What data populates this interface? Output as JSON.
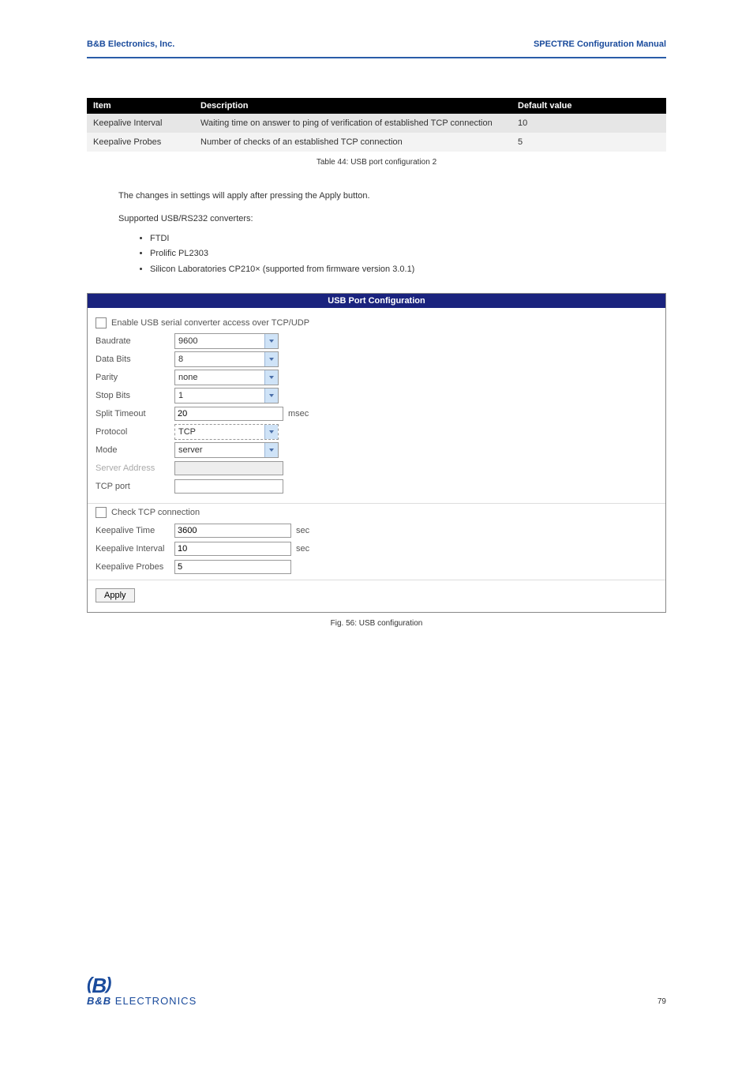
{
  "header": {
    "left": "B&B Electronics, Inc.",
    "right": "SPECTRE Configuration Manual"
  },
  "table": {
    "headers": [
      "Item",
      "Description",
      "Default value"
    ],
    "rows": [
      {
        "item": "Keepalive Interval",
        "desc": "Waiting time on answer to ping of verification of established TCP connection",
        "def": "10"
      },
      {
        "item": "Keepalive Probes",
        "desc": "Number of checks of an established TCP connection",
        "def": "5"
      }
    ],
    "caption": "Table 44: USB port configuration 2"
  },
  "para1": "The changes in settings will apply after pressing the Apply button.",
  "supported_intro": "Supported USB/RS232 converters:",
  "supported": [
    "FTDI",
    "Prolific PL2303",
    "Silicon Laboratories CP210×  (supported from firmware version 3.0.1)"
  ],
  "panel": {
    "title": "USB Port Configuration",
    "enable_label": "Enable USB serial converter access over TCP/UDP",
    "rows": [
      {
        "label": "Baudrate",
        "type": "select",
        "value": "9600"
      },
      {
        "label": "Data Bits",
        "type": "select",
        "value": "8"
      },
      {
        "label": "Parity",
        "type": "select",
        "value": "none"
      },
      {
        "label": "Stop Bits",
        "type": "select",
        "value": "1"
      },
      {
        "label": "Split Timeout",
        "type": "input",
        "value": "20",
        "unit": "msec"
      },
      {
        "label": "Protocol",
        "type": "select",
        "value": "TCP"
      },
      {
        "label": "Mode",
        "type": "select",
        "value": "server"
      },
      {
        "label": "Server Address",
        "type": "input",
        "value": "",
        "disabled": true
      },
      {
        "label": "TCP port",
        "type": "input",
        "value": ""
      }
    ],
    "check2_label": "Check TCP connection",
    "rows2": [
      {
        "label": "Keepalive Time",
        "value": "3600",
        "unit": "sec"
      },
      {
        "label": "Keepalive Interval",
        "value": "10",
        "unit": "sec"
      },
      {
        "label": "Keepalive Probes",
        "value": "5"
      }
    ],
    "apply": "Apply"
  },
  "fig_caption": "Fig. 56: USB configuration",
  "footer": {
    "logo_top": "(B)",
    "logo_bb": "B&B",
    "logo_rest": " ELECTRONICS",
    "page": "79"
  }
}
